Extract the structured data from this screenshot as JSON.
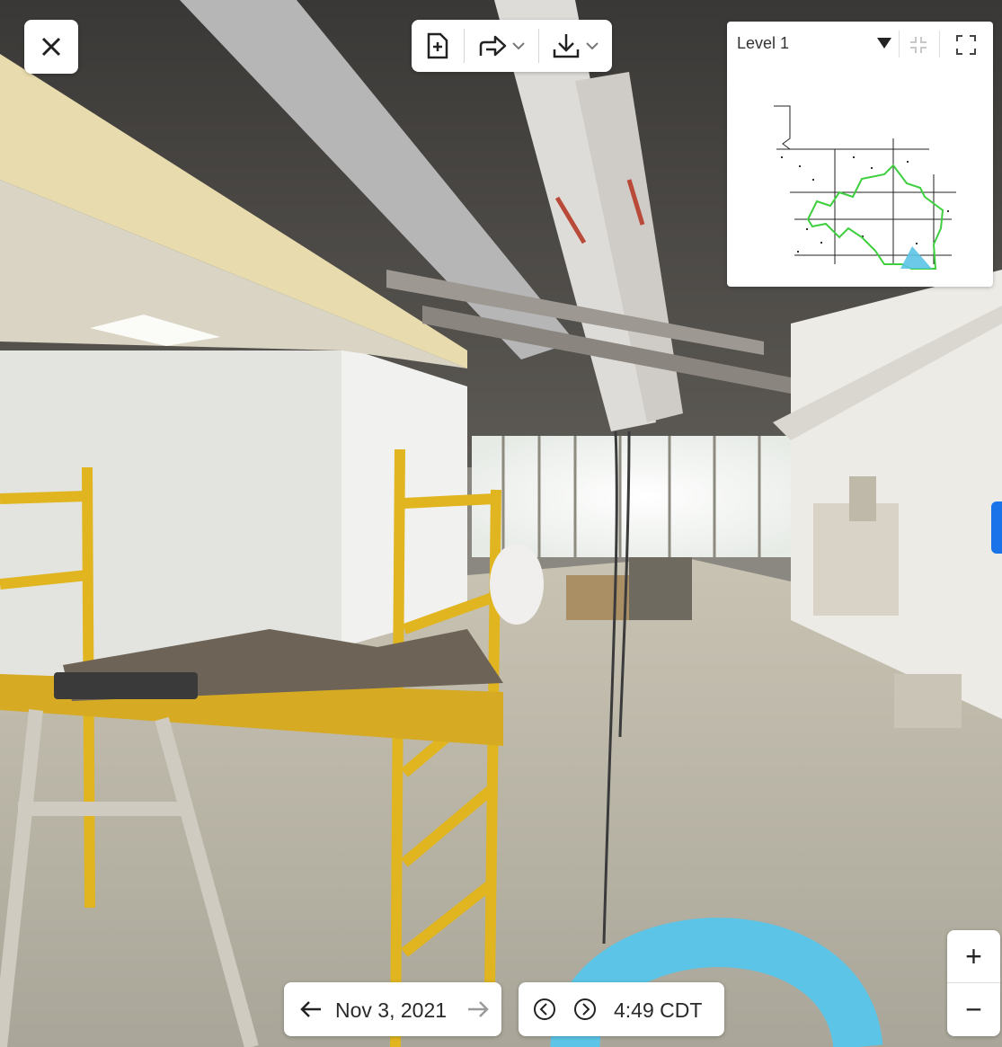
{
  "viewer": {
    "close_icon": "close-icon",
    "toolbar": {
      "add_note_icon": "add-note-icon",
      "share_icon": "share-arrow-icon",
      "download_icon": "download-icon",
      "dropdown_icon": "chevron-down-icon"
    },
    "minimap": {
      "level_label": "Level 1",
      "dropdown_icon": "caret-down-icon",
      "collapse_icon": "collapse-icon",
      "expand_icon": "fullscreen-icon"
    },
    "zoom": {
      "zoom_in_label": "+",
      "zoom_out_label": "−"
    },
    "date_nav": {
      "prev_icon": "arrow-left-icon",
      "date": "Nov 3, 2021",
      "next_icon": "arrow-right-icon"
    },
    "time_nav": {
      "prev_icon": "circle-chevron-left-icon",
      "next_icon": "circle-chevron-right-icon",
      "time": "4:49 CDT"
    },
    "colors": {
      "accent_blue": "#1a73e8",
      "path_green": "#3ecf3e",
      "position_marker": "#5cc4e6"
    }
  }
}
